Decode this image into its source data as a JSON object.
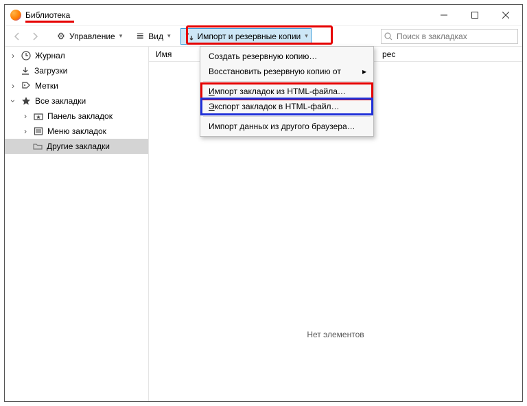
{
  "window": {
    "title": "Библиотека"
  },
  "toolbar": {
    "manage_label": "Управление",
    "view_label": "Вид",
    "import_label": "Импорт и резервные копии"
  },
  "search": {
    "placeholder": "Поиск в закладках"
  },
  "sidebar": {
    "history": "Журнал",
    "downloads": "Загрузки",
    "tags": "Метки",
    "all_bookmarks": "Все закладки",
    "toolbar_bm": "Панель закладок",
    "menu_bm": "Меню закладок",
    "other_bm": "Другие закладки"
  },
  "columns": {
    "name": "Имя",
    "addr": "рес"
  },
  "main": {
    "empty": "Нет элементов"
  },
  "menu": {
    "backup": "Создать резервную копию…",
    "restore": "Восстановить резервную копию от",
    "import_html_pre": "И",
    "import_html_rest": "мпорт закладок из HTML-файла…",
    "export_html_pre": "Э",
    "export_html_rest": "кспорт закладок в HTML-файл…",
    "import_browser": "Импорт данных из другого браузера…"
  }
}
